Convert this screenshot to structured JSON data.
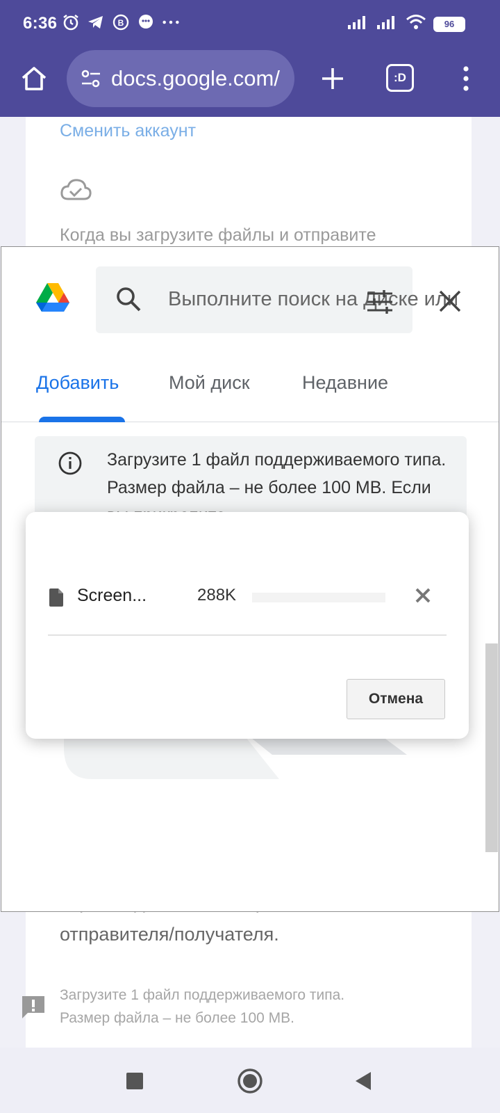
{
  "status": {
    "time": "6:36",
    "battery": "96"
  },
  "browser": {
    "url": "docs.google.com/",
    "tabs_label": ":D"
  },
  "background": {
    "switch_account": "Сменить аккаунт",
    "upload_text": "Когда вы загрузите файлы и отправите",
    "text_line1": "справке должны быть реквизиты",
    "text_line2": "отправителя/получателя.",
    "hint_line1": "Загрузите 1 файл поддерживаемого типа.",
    "hint_line2": "Размер файла – не более 100 MB."
  },
  "picker": {
    "search_placeholder": "Выполните поиск на Диске или",
    "tabs": [
      {
        "label": "Добавить"
      },
      {
        "label": "Мой диск"
      },
      {
        "label": "Недавние"
      }
    ],
    "info_text": "Загрузите 1 файл поддерживаемого типа. Размер файла – не более 100 MB. Если вы прикрепите"
  },
  "upload_dialog": {
    "file_name": "Screen...",
    "file_size": "288K",
    "progress": 0.0,
    "cancel_label": "Отмена"
  },
  "colors": {
    "accent": "#1a73e8",
    "browser_bar": "#4e4a9a"
  }
}
